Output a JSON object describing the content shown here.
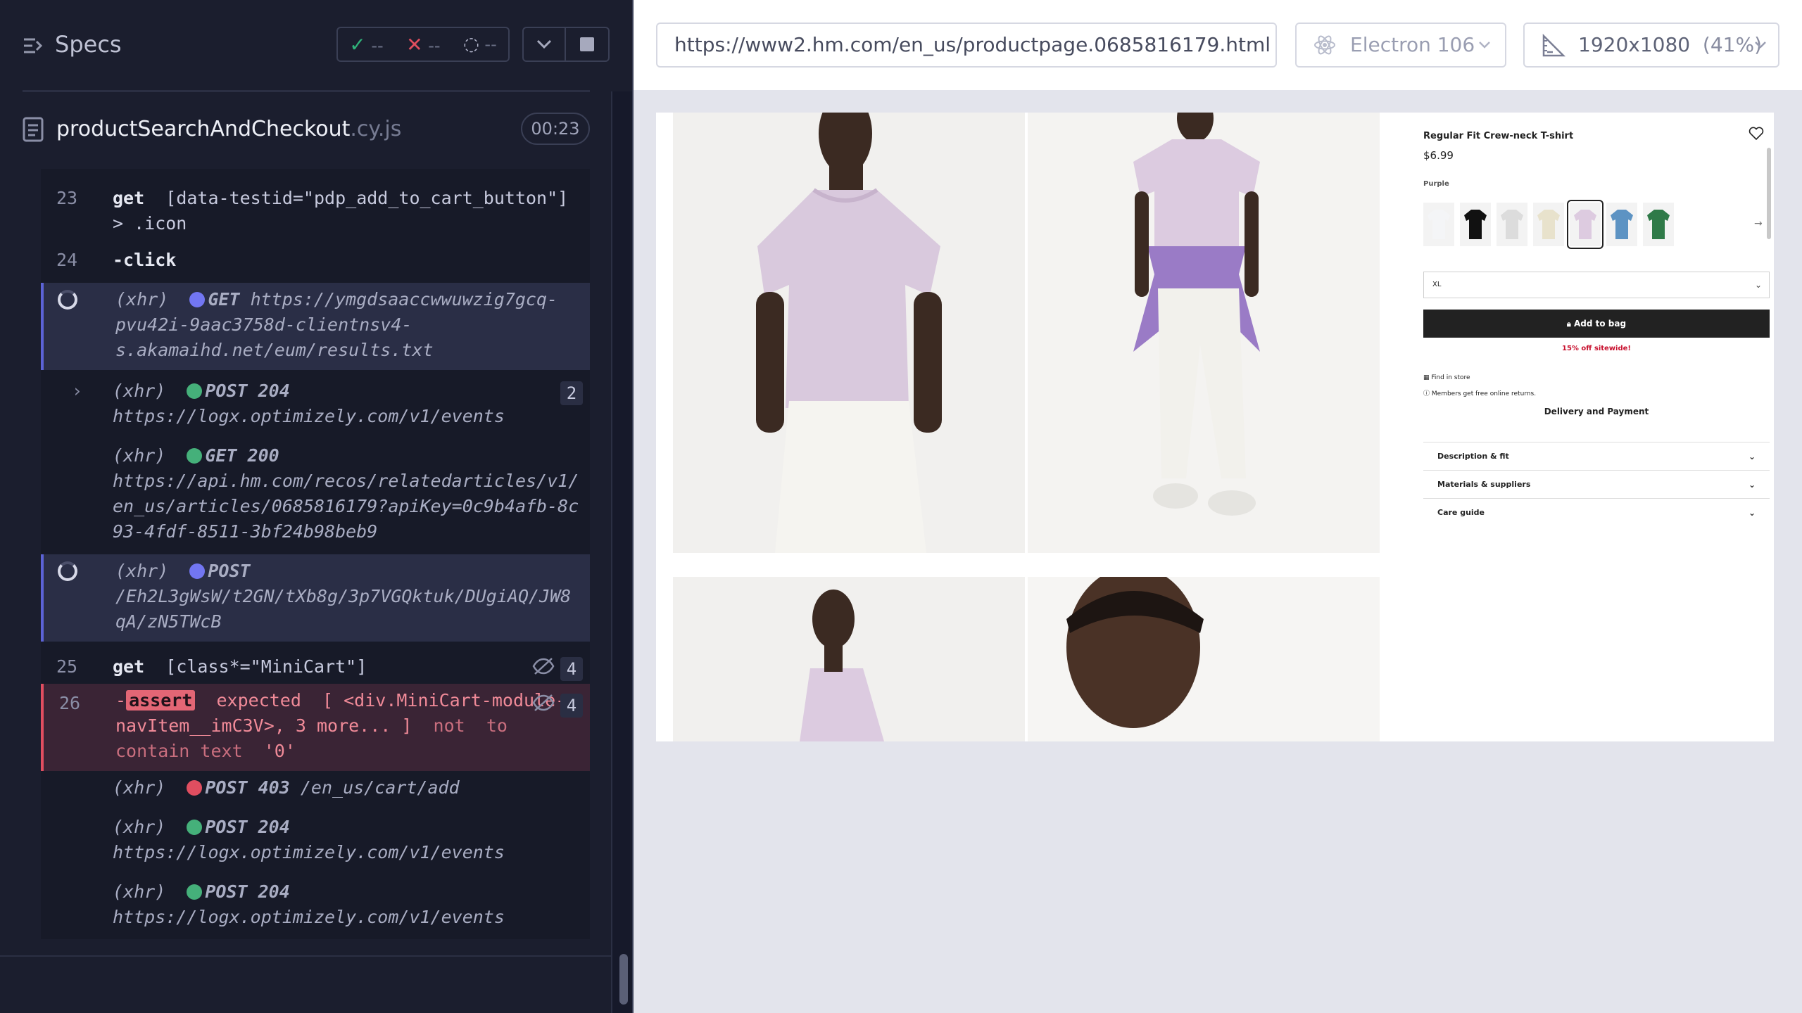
{
  "specs_header": {
    "title": "Specs",
    "passed": "--",
    "failed": "--",
    "pending": "--"
  },
  "spec_file": {
    "name": "productSearchAndCheckout",
    "ext": ".cy.js",
    "duration": "00:23"
  },
  "commands": {
    "c23": {
      "num": "23",
      "name": "get",
      "selector": "[data-testid=\"pdp_add_to_cart_button\"] > .icon"
    },
    "c24": {
      "num": "24",
      "name": "-click"
    },
    "x1": {
      "tag": "(xhr)",
      "method": "GET",
      "url": "https://ymgdsaaccwwuwzig7gcq-pvu42i-9aac3758d-clientnsv4-s.akamaihd.net/eum/results.txt"
    },
    "x2": {
      "tag": "(xhr)",
      "method": "POST 204",
      "url": "https://logx.optimizely.com/v1/events",
      "count": "2"
    },
    "x3": {
      "tag": "(xhr)",
      "method": "GET 200",
      "url": "https://api.hm.com/recos/relatedarticles/v1/en_us/articles/0685816179?apiKey=0c9b4afb-8c93-4fdf-8511-3bf24b98beb9"
    },
    "x4": {
      "tag": "(xhr)",
      "method": "POST",
      "url": "/Eh2L3gWsW/t2GN/tXb8g/3p7VGQktuk/DUgiAQ/JW8qA/zN5TWcB"
    },
    "c25": {
      "num": "25",
      "name": "get",
      "selector": "[class*=\"MiniCart\"]",
      "count": "4"
    },
    "c26": {
      "num": "26",
      "name": "-",
      "tag": "assert",
      "text1": "expected",
      "text2": "[ <div.MiniCart-module--navItem__imC3V>, 3 more... ]",
      "text3": "not",
      "text4": "to contain text",
      "text5": "'0'",
      "count": "4"
    },
    "x5": {
      "tag": "(xhr)",
      "method": "POST 403",
      "url": "/en_us/cart/add"
    },
    "x6": {
      "tag": "(xhr)",
      "method": "POST 204",
      "url": "https://logx.optimizely.com/v1/events"
    },
    "x7": {
      "tag": "(xhr)",
      "method": "POST 204",
      "url": "https://logx.optimizely.com/v1/events"
    }
  },
  "topbar": {
    "url": "https://www2.hm.com/en_us/productpage.0685816179.html",
    "browser": "Electron 106",
    "viewport": "1920x1080",
    "scale": "(41%)"
  },
  "product": {
    "title": "Regular Fit Crew-neck T-shirt",
    "price": "$6.99",
    "color": "Purple",
    "swatches": [
      "#f4f5f7",
      "#111111",
      "#dcdcdc",
      "#e8e2cc",
      "#ddcbe0",
      "#5d93c3",
      "#2f7a48"
    ],
    "size": "XL",
    "add_to_bag": "Add to bag",
    "promo": "15% off sitewide!",
    "find_in_store": "Find in store",
    "members": "Members get free online returns.",
    "delivery": "Delivery and Payment",
    "accordion": [
      "Description & fit",
      "Materials & suppliers",
      "Care guide"
    ]
  },
  "colors": {
    "pass": "#2fb37a",
    "fail": "#e04e5e",
    "accent": "#7276f2"
  }
}
